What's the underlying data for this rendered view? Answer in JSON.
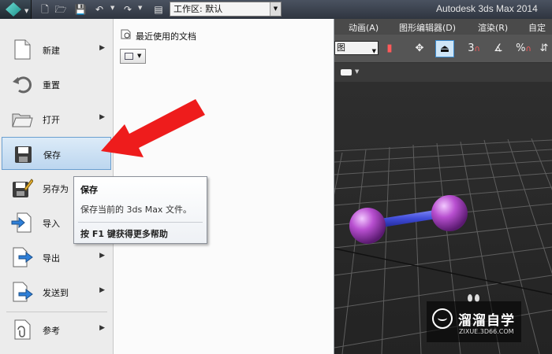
{
  "title_bar": {
    "app_title": "Autodesk 3ds Max  2014",
    "workspace_value": "工作区: 默认"
  },
  "menu_bar": {
    "items": [
      "动画(A)",
      "图形编辑器(D)",
      "渲染(R)",
      "自定"
    ]
  },
  "toolbar": {
    "selection_filter": "图",
    "snap_label": "3",
    "percent_label": "%"
  },
  "app_menu": {
    "commands": [
      {
        "label": "新建",
        "icon": "new-file-icon",
        "has_submenu": true
      },
      {
        "label": "重置",
        "icon": "reset-icon",
        "has_submenu": false
      },
      {
        "label": "打开",
        "icon": "open-folder-icon",
        "has_submenu": true
      },
      {
        "label": "保存",
        "icon": "save-disk-icon",
        "has_submenu": false
      },
      {
        "label": "另存为",
        "icon": "save-as-icon",
        "has_submenu": true
      },
      {
        "label": "导入",
        "icon": "import-icon",
        "has_submenu": true
      },
      {
        "label": "导出",
        "icon": "export-icon",
        "has_submenu": true
      },
      {
        "label": "发送到",
        "icon": "send-to-icon",
        "has_submenu": true
      },
      {
        "label": "参考",
        "icon": "reference-icon",
        "has_submenu": true
      }
    ],
    "recent_docs_title": "最近使用的文档"
  },
  "tooltip": {
    "title": "保存",
    "description": "保存当前的 3ds Max 文件。",
    "help": "按 F1 键获得更多帮助"
  },
  "watermark": {
    "name": "溜溜自学",
    "url": "ZIXUE.3D66.COM"
  },
  "colors": {
    "highlight_bg": "#bcd6ef",
    "arrow": "#ee1c1c",
    "sphere": "#b84fd0",
    "rod": "#3f4bd8"
  }
}
